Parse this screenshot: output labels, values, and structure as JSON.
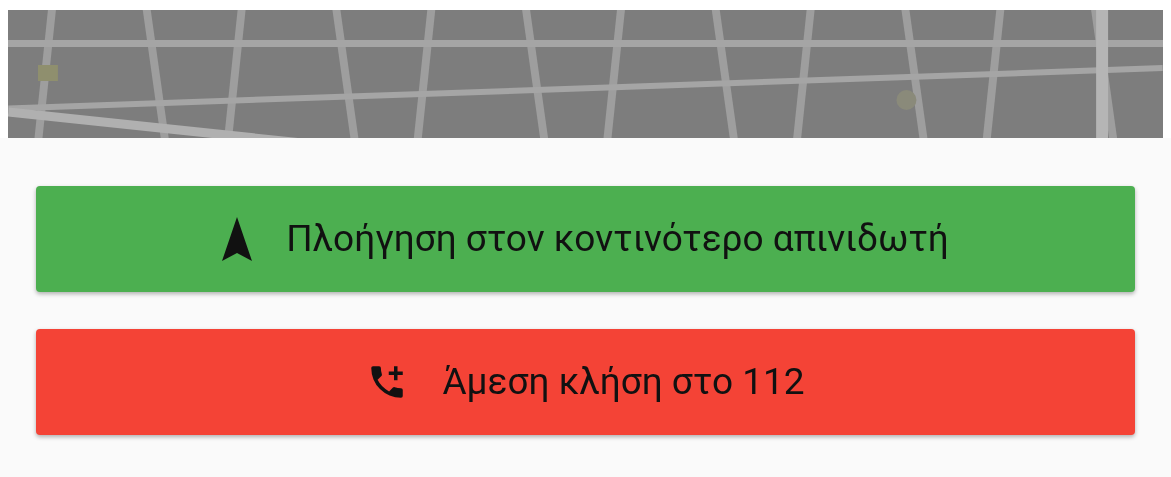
{
  "buttons": [
    {
      "kind": "navigate",
      "label": "Πλοήγηση στον κοντινότερο απινιδωτή"
    },
    {
      "kind": "call",
      "label": "Άμεση κλήση στο 112"
    }
  ]
}
